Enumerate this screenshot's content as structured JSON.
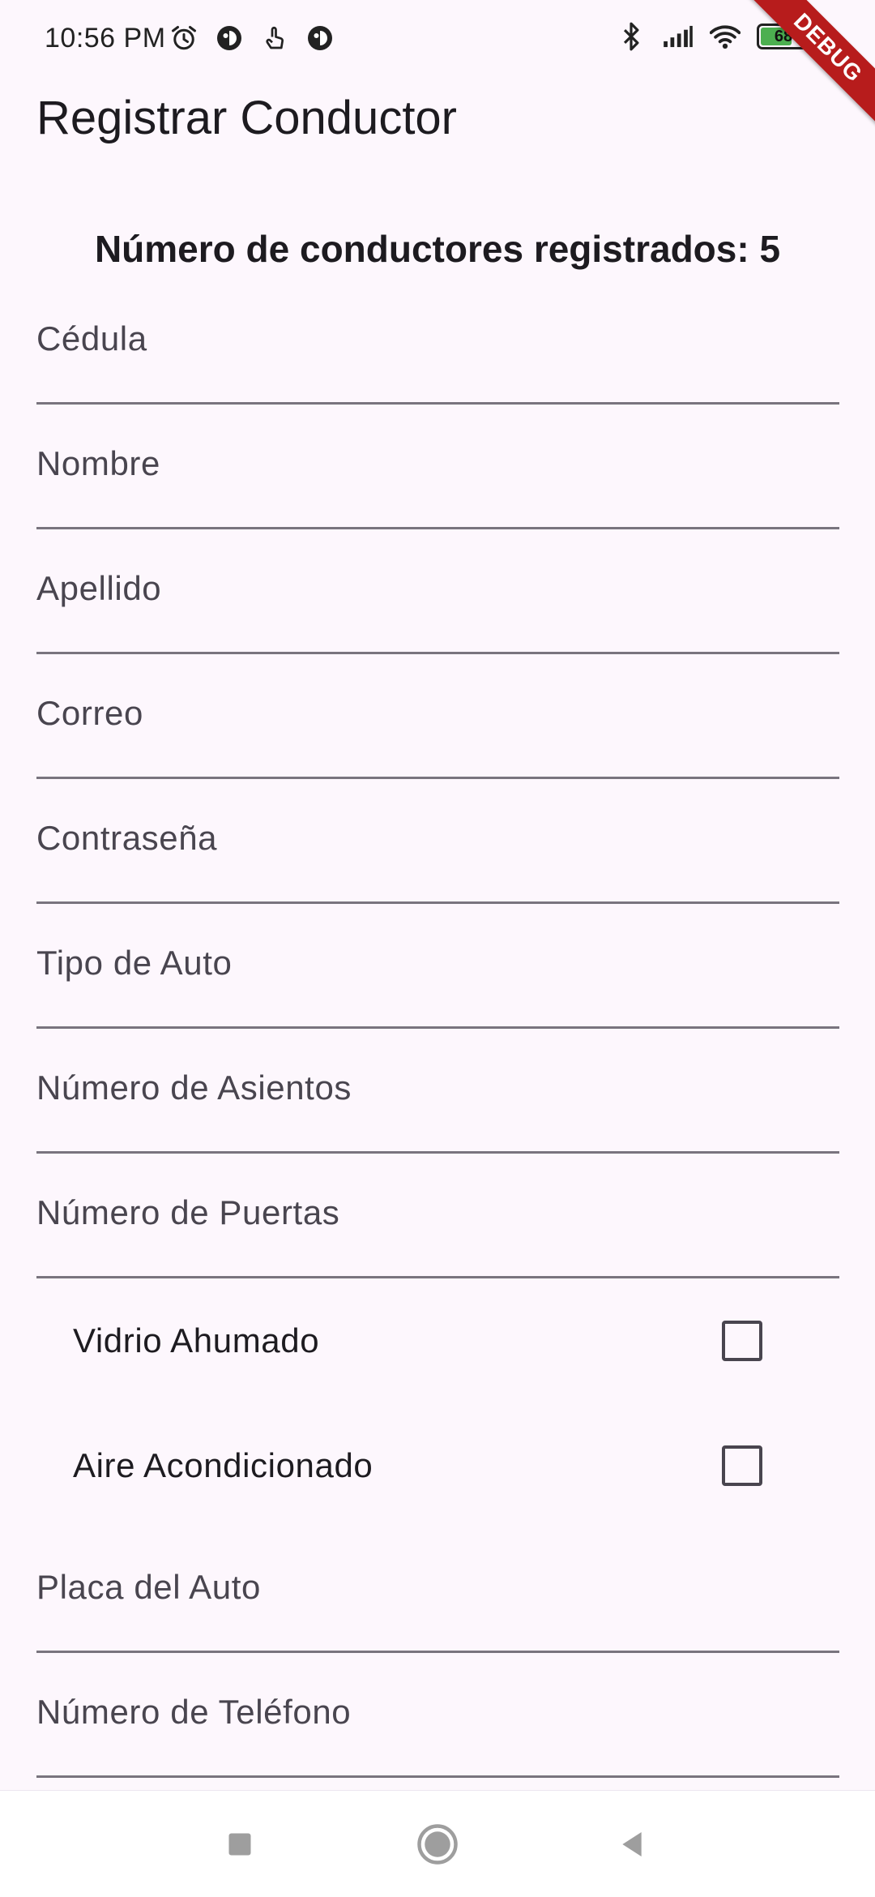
{
  "status_bar": {
    "time": "10:56 PM",
    "battery_level": "68",
    "battery_fraction": 0.68,
    "icons_left": [
      "alarm-icon",
      "app-notification-icon",
      "touch-icon",
      "app-notification-icon"
    ],
    "icons_right": [
      "bluetooth-icon",
      "signal-icon",
      "wifi-icon",
      "battery-icon",
      "charging-icon"
    ]
  },
  "debug_banner": "DEBUG",
  "app_bar": {
    "title": "Registrar Conductor"
  },
  "counter": {
    "text": "Número de conductores registrados: 5"
  },
  "form": {
    "cedula": {
      "placeholder": "Cédula",
      "value": ""
    },
    "nombre": {
      "placeholder": "Nombre",
      "value": ""
    },
    "apellido": {
      "placeholder": "Apellido",
      "value": ""
    },
    "correo": {
      "placeholder": "Correo",
      "value": ""
    },
    "contrasena": {
      "placeholder": "Contraseña",
      "value": ""
    },
    "tipo_auto": {
      "placeholder": "Tipo de Auto",
      "value": ""
    },
    "num_asientos": {
      "placeholder": "Número de Asientos",
      "value": ""
    },
    "num_puertas": {
      "placeholder": "Número de Puertas",
      "value": ""
    },
    "vidrio_ahumado": {
      "label": "Vidrio Ahumado",
      "checked": false
    },
    "aire_acondicionado": {
      "label": "Aire Acondicionado",
      "checked": false
    },
    "placa_auto": {
      "placeholder": "Placa del Auto",
      "value": ""
    },
    "telefono": {
      "placeholder": "Número de Teléfono",
      "value": ""
    }
  },
  "nav_bar": {
    "buttons": [
      "recent-apps-icon",
      "home-icon",
      "back-icon"
    ]
  },
  "colors": {
    "background": "#FDF7FD",
    "underline": "#79747E",
    "text": "#1D1B20",
    "placeholder": "#49454F",
    "debug_banner": "#B71C1C",
    "battery_fill": "#4CAF50"
  }
}
